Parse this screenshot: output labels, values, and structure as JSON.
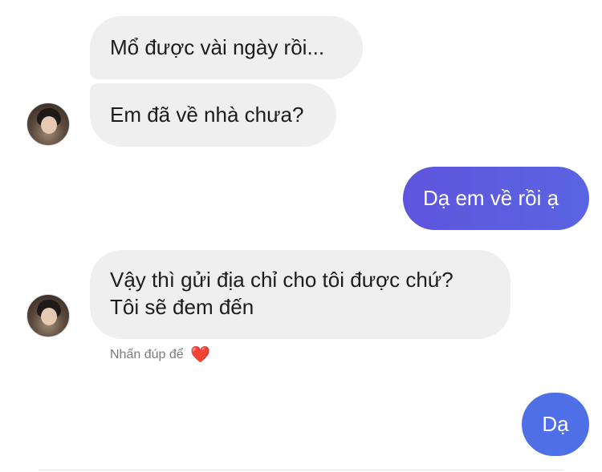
{
  "messages": {
    "m1": "Mổ được vài ngày rồi...",
    "m2": "Em đã về nhà chưa?",
    "m3": "Dạ em về rồi ạ",
    "m4_line1": "Vậy thì gửi địa chỉ cho tôi được chứ?",
    "m4_line2": "Tôi sẽ đem đến",
    "m5": "Dạ"
  },
  "hint": {
    "text": "Nhấn đúp để",
    "icon": "heart-icon",
    "heart_glyph": "❤️"
  },
  "colors": {
    "incoming_bubble": "#efefef",
    "outgoing_gradient_start": "#5f55dd",
    "outgoing_gradient_end": "#5a64e2",
    "outgoing_last": "#4f6fe6",
    "hint_text": "#7b7b7f"
  }
}
